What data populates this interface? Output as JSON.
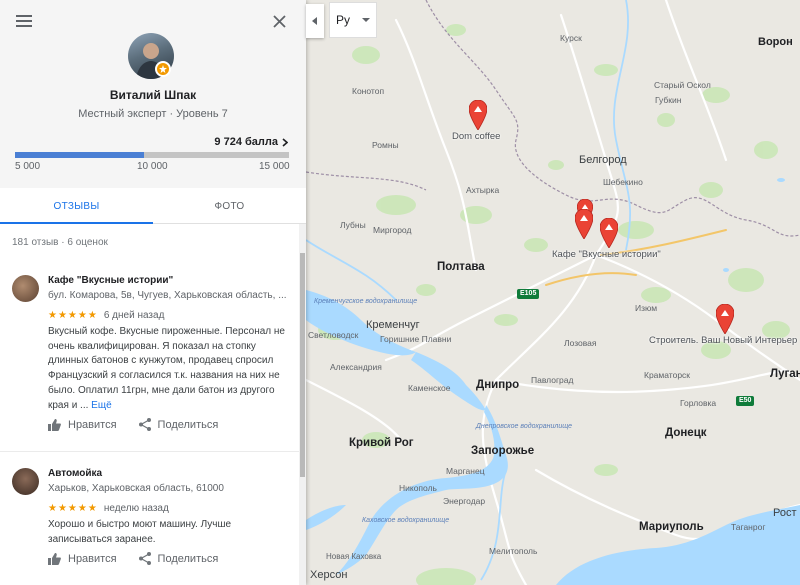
{
  "profile": {
    "name": "Виталий Шпак",
    "level": "Местный эксперт · Уровень 7",
    "points": "9 724 балла",
    "progress": {
      "min": 5000,
      "max": 15000,
      "value": 9724
    },
    "ticks": [
      "5 000",
      "10 000",
      "15 000"
    ]
  },
  "tabs": {
    "reviews": "ОТЗЫВЫ",
    "photos": "ФОТО"
  },
  "summary": "181 отзыв · 6 оценок",
  "reviews": [
    {
      "title": "Кафе \"Вкусные истории\"",
      "address": "бул. Комарова, 5в, Чугуев, Харьковская область, ...",
      "stars": "★★★★★",
      "date": "6 дней назад",
      "text": "Вкусный кофе. Вкусные пироженные. Персонал не очень квалифицирован. Я показал на стопку длинных батонов с кунжутом, продавец спросил Французский я согласился т.к. названия на них не было. Оплатил 11грн, мне дали батон из другого края и ...",
      "more": "Ещё",
      "like": "Нравится",
      "share": "Поделиться"
    },
    {
      "title": "Автомойка",
      "address": "Харьков, Харьковская область, 61000",
      "stars": "★★★★★",
      "date": "неделю назад",
      "text": "Хорошо и быстро моют машину. Лучше записываться заранее.",
      "like": "Нравится",
      "share": "Поделиться"
    }
  ],
  "map": {
    "language": "Ру",
    "labels": {
      "kursk": "Курск",
      "voronezh": "Ворон",
      "stary_oskol": "Старый Оскол",
      "gubkin": "Губкин",
      "konotop": "Конотоп",
      "romny": "Ромны",
      "belgorod": "Белгород",
      "shebekino": "Шебекино",
      "akhtyrka": "Ахтырка",
      "lubny": "Лубны",
      "mirgorod": "Миргород",
      "poltava": "Полтава",
      "kremenchug": "Кременчуг",
      "svetlovodsk": "Светловодск",
      "gorishnie_plavni": "Горишние Плавни",
      "aleksandriya": "Александрия",
      "kamenskoe": "Каменское",
      "dnipro": "Днипро",
      "pavlograd": "Павлоград",
      "lozovaya": "Лозовая",
      "izyum": "Изюм",
      "kramatorsk": "Краматорск",
      "lugansk": "Луган",
      "gorlovka": "Горловка",
      "donetsk": "Донецк",
      "krivoy_rog": "Кривой Рог",
      "zaporozhye": "Запорожье",
      "marganets": "Марганец",
      "nikopol": "Никополь",
      "energodar": "Энергодар",
      "melitopol": "Мелитополь",
      "mariupol": "Мариуполь",
      "rostov": "Рост",
      "kherson": "Херсон",
      "novaya_kakhovka": "Новая Каховка",
      "taganrog": "Таганрог"
    },
    "water_labels": {
      "kremenchug_res": "Кременчугское водохранилище",
      "dniprovskoe_res": "Днепровское водохранилище",
      "kakhovka_res": "Каховское водохранилище"
    },
    "roads": {
      "e105": "E105",
      "e50": "E50"
    },
    "pins": {
      "dom_coffee": "Dom coffee",
      "cafe": "Кафе \"Вкусные истории\"",
      "stroitel": "Строитель. Ваш Новый Интерьер"
    },
    "colors": {
      "pin": "#ea4335",
      "water": "#aadaff",
      "park": "#c8e6b4",
      "progress": "#4a7fd4",
      "accent": "#1a73e8",
      "star": "#f29900"
    }
  }
}
